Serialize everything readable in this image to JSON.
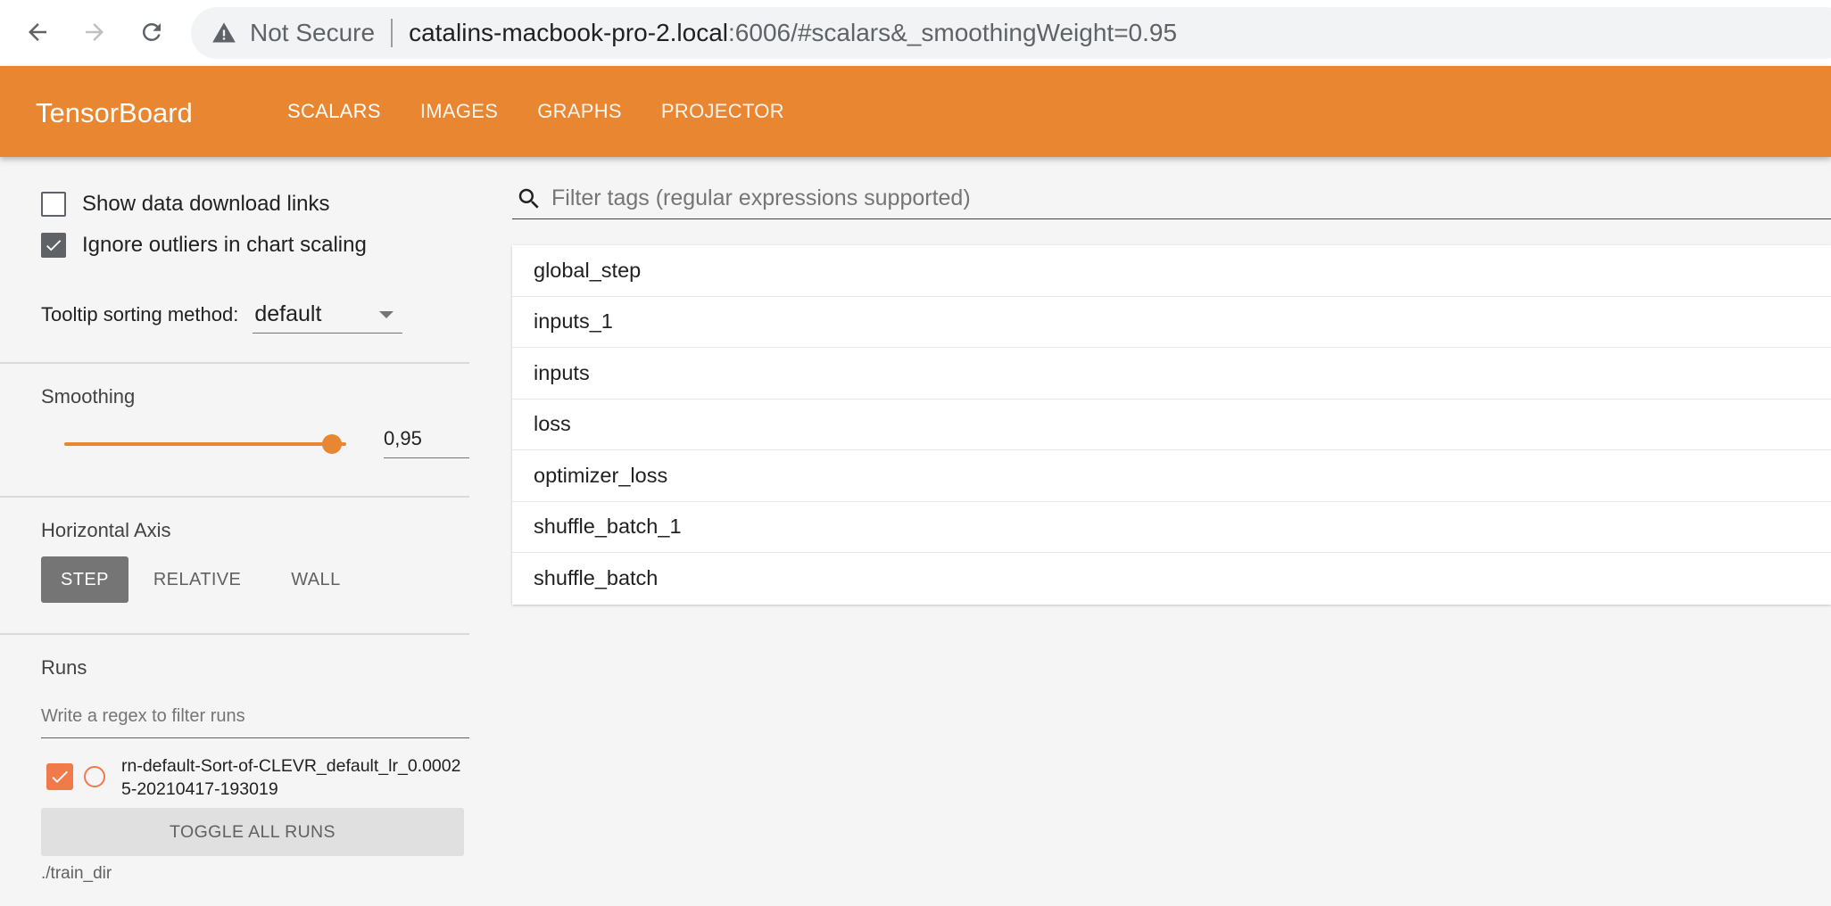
{
  "browser": {
    "not_secure_label": "Not Secure",
    "url_host": "catalins-macbook-pro-2.local",
    "url_rest": ":6006/#scalars&_smoothingWeight=0.95"
  },
  "header": {
    "brand": "TensorBoard",
    "tabs": [
      {
        "label": "SCALARS"
      },
      {
        "label": "IMAGES"
      },
      {
        "label": "GRAPHS"
      },
      {
        "label": "PROJECTOR"
      }
    ],
    "color": "#e88632"
  },
  "sidebar": {
    "show_download_links": {
      "label": "Show data download links",
      "checked": false
    },
    "ignore_outliers": {
      "label": "Ignore outliers in chart scaling",
      "checked": true
    },
    "tooltip_label": "Tooltip sorting method:",
    "tooltip_value": "default",
    "smoothing_label": "Smoothing",
    "smoothing_value": "0,95",
    "smoothing_fraction": 0.95,
    "horizontal_axis_label": "Horizontal Axis",
    "axis_options": [
      {
        "label": "STEP"
      },
      {
        "label": "RELATIVE"
      },
      {
        "label": "WALL"
      }
    ],
    "axis_selected": "STEP",
    "runs_label": "Runs",
    "runs_filter_placeholder": "Write a regex to filter runs",
    "runs": [
      {
        "name": "rn-default-Sort-of-CLEVR_default_lr_0.00025-20210417-193019",
        "checked": true,
        "color": "#f07a4a"
      }
    ],
    "toggle_all_label": "TOGGLE ALL RUNS",
    "logdir": "./train_dir"
  },
  "main": {
    "filter_placeholder": "Filter tags (regular expressions supported)",
    "tags": [
      {
        "label": "global_step"
      },
      {
        "label": "inputs_1"
      },
      {
        "label": "inputs"
      },
      {
        "label": "loss"
      },
      {
        "label": "optimizer_loss"
      },
      {
        "label": "shuffle_batch_1"
      },
      {
        "label": "shuffle_batch"
      }
    ]
  }
}
